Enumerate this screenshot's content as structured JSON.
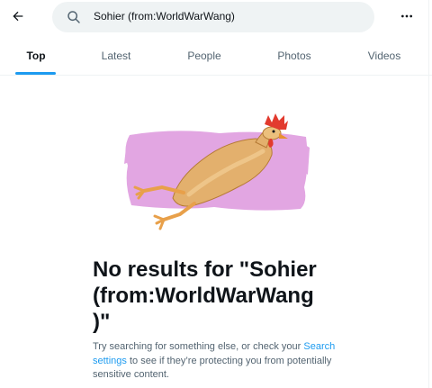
{
  "header": {
    "back_icon": "arrow-left-icon",
    "search_value": "Sohier (from:WorldWarWang)",
    "search_icon": "search-icon",
    "more_icon": "more-horizontal-icon"
  },
  "tabs": [
    {
      "label": "Top",
      "active": true
    },
    {
      "label": "Latest",
      "active": false
    },
    {
      "label": "People",
      "active": false
    },
    {
      "label": "Photos",
      "active": false
    },
    {
      "label": "Videos",
      "active": false
    }
  ],
  "empty_state": {
    "illustration": "rubber-chicken-illustration",
    "title_line1": "No results for \"Sohier",
    "title_line2": "(from:WorldWarWang",
    "title_line3": ")\"",
    "desc_before": "Try searching for something else, or check your",
    "desc_link": "Search settings",
    "desc_after": " to see if they’re protecting you from potentially sensitive content."
  },
  "colors": {
    "accent": "#1d9bf0",
    "text_primary": "#0f1419",
    "text_secondary": "#536471",
    "search_bg": "#eff3f4",
    "illustration_bg": "#e2a6e2"
  }
}
